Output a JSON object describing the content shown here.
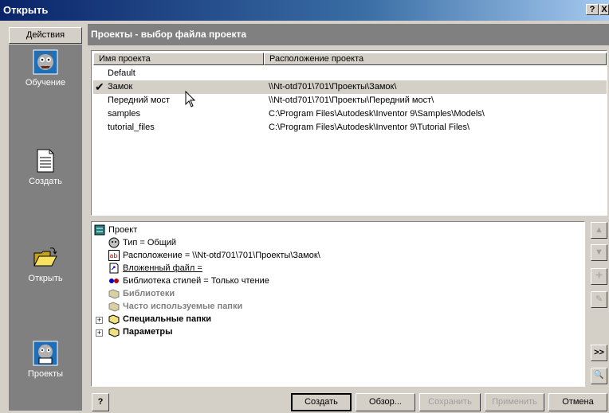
{
  "window": {
    "title": "Открыть",
    "help_label": "?",
    "close_label": "X"
  },
  "sidebar": {
    "actions_label": "Действия",
    "items": [
      {
        "label": "Обучение",
        "icon": "monster-face-icon"
      },
      {
        "label": "Создать",
        "icon": "document-icon"
      },
      {
        "label": "Открыть",
        "icon": "open-folder-icon"
      },
      {
        "label": "Проекты",
        "icon": "projects-icon"
      }
    ]
  },
  "header": {
    "title": "Проекты - выбор файла проекта"
  },
  "projects_table": {
    "columns": [
      "Имя проекта",
      "Расположение проекта"
    ],
    "rows": [
      {
        "name": "Default",
        "location": "",
        "active": false
      },
      {
        "name": "Замок",
        "location": "\\\\Nt-otd701\\701\\Проекты\\Замок\\",
        "active": true
      },
      {
        "name": "Передний мост",
        "location": "\\\\Nt-otd701\\701\\Проекты\\Передний мост\\",
        "active": false
      },
      {
        "name": "samples",
        "location": "C:\\Program Files\\Autodesk\\Inventor 9\\Samples\\Models\\",
        "active": false
      },
      {
        "name": "tutorial_files",
        "location": "C:\\Program Files\\Autodesk\\Inventor 9\\Tutorial Files\\",
        "active": false
      }
    ]
  },
  "tree": {
    "root": "Проект",
    "items": [
      {
        "label": "Тип = Общий"
      },
      {
        "label": "Расположение = \\\\Nt-otd701\\701\\Проекты\\Замок\\"
      },
      {
        "label": "Вложенный файл ="
      },
      {
        "label": "Библиотека стилей = Только чтение"
      },
      {
        "label": "Библиотеки"
      },
      {
        "label": "Часто используемые папки"
      },
      {
        "label": "Специальные папки"
      },
      {
        "label": "Параметры"
      }
    ]
  },
  "side_buttons": {
    "up": "▲",
    "down": "▼",
    "add": "+",
    "edit": "✎",
    "more": ">>",
    "find": "🔍"
  },
  "buttons": {
    "help": "?",
    "create": "Создать",
    "browse": "Обзор...",
    "save": "Сохранить",
    "apply": "Применить",
    "cancel": "Отмена"
  }
}
